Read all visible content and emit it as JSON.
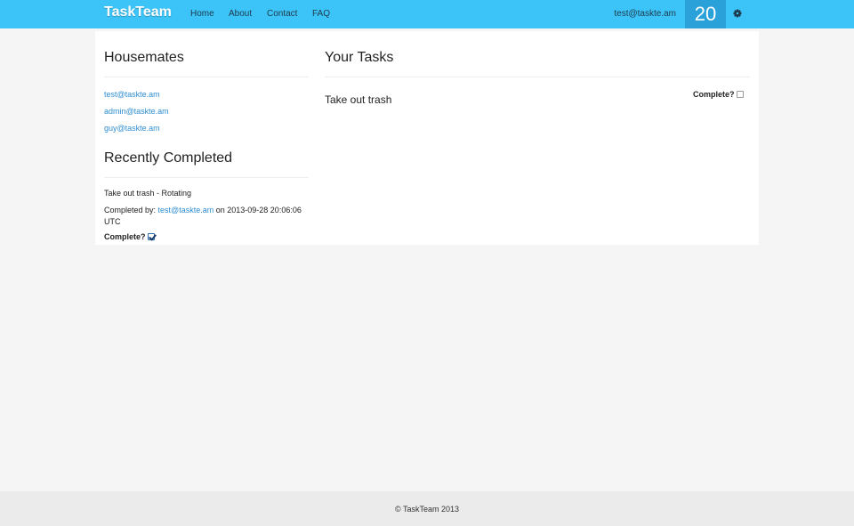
{
  "navbar": {
    "brand": "TaskTeam",
    "links": [
      "Home",
      "About",
      "Contact",
      "FAQ"
    ],
    "user_email": "test@taskte.am",
    "counter": "20",
    "colors": {
      "bar": "#3cc4f8",
      "counter_bg": "#2aa2d9"
    }
  },
  "housemates": {
    "title": "Housemates",
    "members": [
      "test@taskte.am",
      "admin@taskte.am",
      "guy@taskte.am"
    ]
  },
  "recently_completed": {
    "title": "Recently Completed",
    "task_name": "Take out trash - Rotating",
    "completed_by_prefix": "Completed by:",
    "completed_by_user": "test@taskte.am",
    "on_text": "on",
    "timestamp": "2013-09-28 20:06:06",
    "timezone": "UTC",
    "complete_label": "Complete?",
    "complete_checked": true
  },
  "your_tasks": {
    "title": "Your Tasks",
    "tasks": [
      {
        "name": "Take out trash",
        "complete_label": "Complete?",
        "complete_checked": false
      }
    ]
  },
  "footer": {
    "text": "© TaskTeam 2013"
  }
}
